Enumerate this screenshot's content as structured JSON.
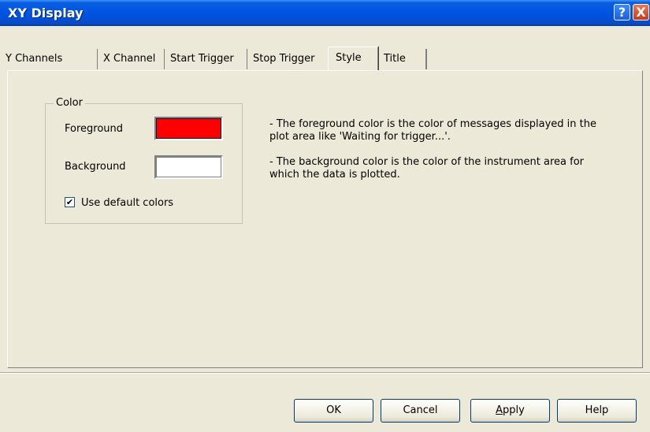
{
  "window": {
    "title": "XY Display"
  },
  "titlebar_buttons": {
    "help": "?",
    "close": "X"
  },
  "tabs": [
    "Y Channels",
    "X Channel",
    "Start Trigger",
    "Stop Trigger",
    "Style",
    "Title"
  ],
  "active_tab": "Style",
  "color_group": {
    "legend": "Color",
    "foreground_label": "Foreground",
    "foreground_color": "#ff0000",
    "background_label": "Background",
    "background_color": "#ffffff",
    "use_default_label": "Use default colors",
    "use_default_checked": true
  },
  "descriptions": {
    "foreground": "- The foreground color is the color of messages displayed in the plot area like 'Waiting for trigger...'.",
    "background": "- The background color is the color of the instrument area for which the data is plotted."
  },
  "buttons": {
    "ok": "OK",
    "cancel": "Cancel",
    "apply": "Apply",
    "help": "Help"
  }
}
